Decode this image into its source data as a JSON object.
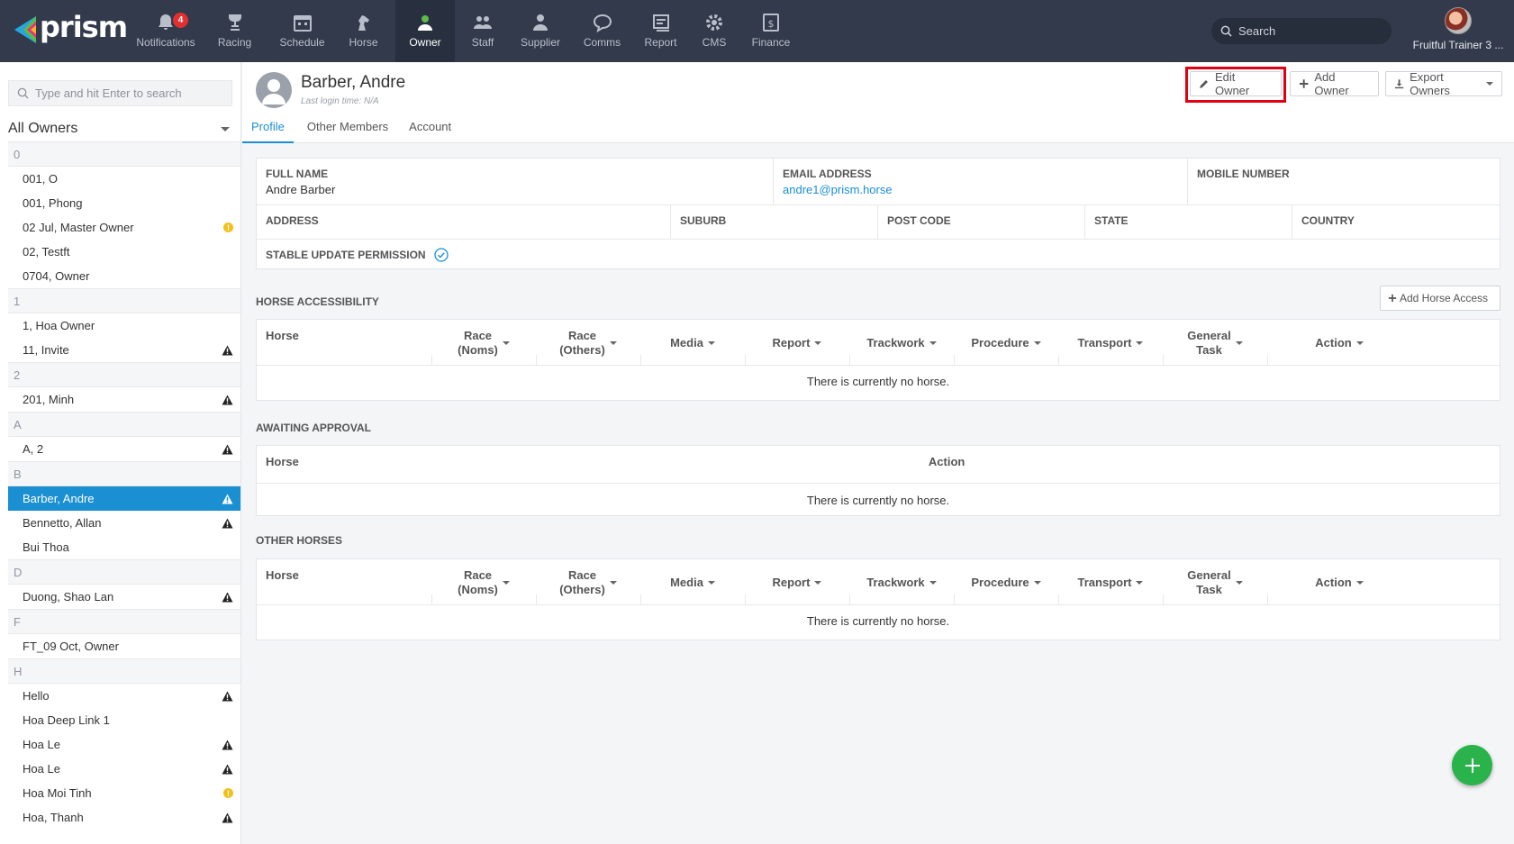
{
  "brand": {
    "name": "prism"
  },
  "nav": {
    "items": [
      {
        "label": "Notifications",
        "icon": "bell-icon",
        "badge": "4"
      },
      {
        "label": "Racing",
        "icon": "trophy-icon"
      },
      {
        "label": "Schedule",
        "icon": "calendar-icon"
      },
      {
        "label": "Horse",
        "icon": "horse-icon"
      },
      {
        "label": "Owner",
        "icon": "user-icon",
        "active": true
      },
      {
        "label": "Staff",
        "icon": "staff-icon"
      },
      {
        "label": "Supplier",
        "icon": "supplier-icon"
      },
      {
        "label": "Comms",
        "icon": "chat-icon"
      },
      {
        "label": "Report",
        "icon": "report-icon"
      },
      {
        "label": "CMS",
        "icon": "gear-icon"
      },
      {
        "label": "Finance",
        "icon": "finance-icon"
      }
    ],
    "search_placeholder": "Search",
    "user_name": "Fruitful Trainer 3 ..."
  },
  "sidebar": {
    "search_placeholder": "Type and hit Enter to search",
    "filter_label": "All Owners",
    "groups": [
      {
        "letter": "0",
        "items": [
          {
            "name": "001, O",
            "flag": ""
          },
          {
            "name": "001, Phong",
            "flag": ""
          },
          {
            "name": "02 Jul, Master Owner",
            "flag": "info"
          },
          {
            "name": "02, Testft",
            "flag": ""
          },
          {
            "name": "0704, Owner",
            "flag": ""
          }
        ]
      },
      {
        "letter": "1",
        "items": [
          {
            "name": "1, Hoa Owner",
            "flag": ""
          },
          {
            "name": "11, Invite",
            "flag": "warn"
          }
        ]
      },
      {
        "letter": "2",
        "items": [
          {
            "name": "201, Minh",
            "flag": "warn"
          }
        ]
      },
      {
        "letter": "A",
        "items": [
          {
            "name": "A, 2",
            "flag": "warn"
          }
        ]
      },
      {
        "letter": "B",
        "items": [
          {
            "name": "Barber, Andre",
            "flag": "warn",
            "selected": true
          },
          {
            "name": "Bennetto, Allan",
            "flag": "warn"
          },
          {
            "name": "Bui Thoa",
            "flag": ""
          }
        ]
      },
      {
        "letter": "D",
        "items": [
          {
            "name": "Duong, Shao Lan",
            "flag": "warn"
          }
        ]
      },
      {
        "letter": "F",
        "items": [
          {
            "name": "FT_09 Oct, Owner",
            "flag": ""
          }
        ]
      },
      {
        "letter": "H",
        "items": [
          {
            "name": "Hello",
            "flag": "warn"
          },
          {
            "name": "Hoa Deep Link 1",
            "flag": ""
          },
          {
            "name": "Hoa Le",
            "flag": "warn"
          },
          {
            "name": "Hoa Le",
            "flag": "warn"
          },
          {
            "name": "Hoa Moi Tinh",
            "flag": "info"
          },
          {
            "name": "Hoa, Thanh",
            "flag": "warn"
          }
        ]
      }
    ]
  },
  "profile": {
    "name": "Barber, Andre",
    "last_login": "Last login time: N/A",
    "tabs": [
      "Profile",
      "Other Members",
      "Account"
    ],
    "buttons": {
      "edit": "Edit Owner",
      "add": "Add Owner",
      "export": "Export Owners"
    },
    "fields": {
      "full_name_label": "FULL NAME",
      "full_name": "Andre Barber",
      "email_label": "EMAIL ADDRESS",
      "email": "andre1@prism.horse",
      "mobile_label": "MOBILE NUMBER",
      "address_label": "ADDRESS",
      "suburb_label": "SUBURB",
      "postcode_label": "POST CODE",
      "state_label": "STATE",
      "country_label": "COUNTRY",
      "stable_label": "STABLE UPDATE PERMISSION"
    }
  },
  "horse_accessibility": {
    "title": "HORSE ACCESSIBILITY",
    "add_button": "Add Horse Access",
    "columns": [
      "Horse",
      "Race (Noms)",
      "Race (Others)",
      "Media",
      "Report",
      "Trackwork",
      "Procedure",
      "Transport",
      "General Task",
      "Action"
    ],
    "empty": "There is currently no horse."
  },
  "awaiting_approval": {
    "title": "AWAITING APPROVAL",
    "columns": [
      "Horse",
      "Action"
    ],
    "empty": "There is currently no horse."
  },
  "other_horses": {
    "title": "OTHER HORSES",
    "columns": [
      "Horse",
      "Race (Noms)",
      "Race (Others)",
      "Media",
      "Report",
      "Trackwork",
      "Procedure",
      "Transport",
      "General Task",
      "Action"
    ],
    "empty": "There is currently no horse."
  },
  "colors": {
    "nav_bg": "#323a4b",
    "accent": "#1a8fd1",
    "highlight": "#e00012",
    "fab": "#29b34a",
    "warn": "#222222",
    "info": "#f2c01e"
  }
}
